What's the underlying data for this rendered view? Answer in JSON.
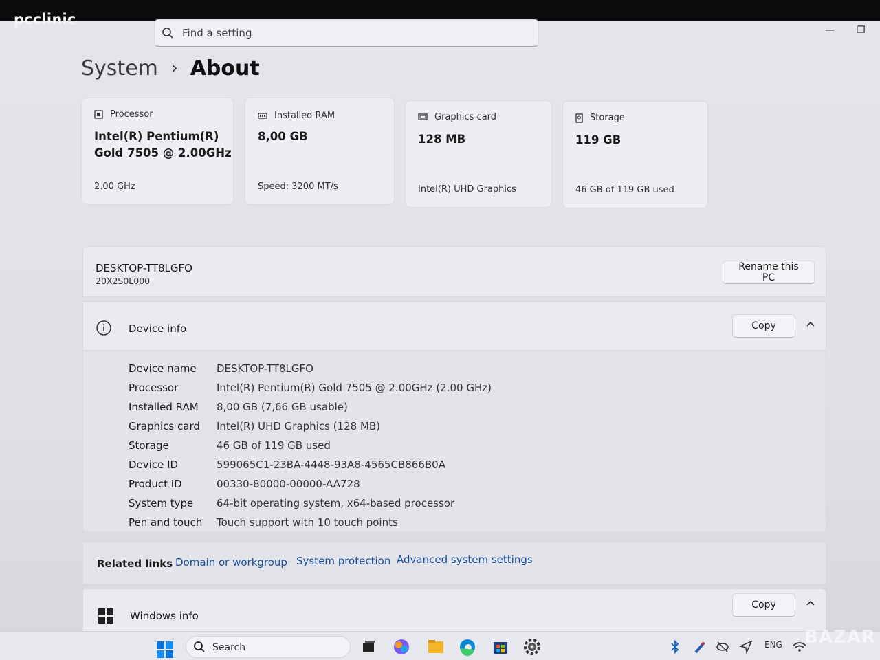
{
  "brand": "pcclinic",
  "search": {
    "placeholder": "Find a setting"
  },
  "breadcrumb": {
    "parent": "System",
    "current": "About"
  },
  "cards": [
    {
      "label": "Processor",
      "value_line1": "Intel(R) Pentium(R)",
      "value_line2": "Gold 7505 @ 2.00GHz",
      "sub": "2.00 GHz",
      "icon": "processor-icon"
    },
    {
      "label": "Installed RAM",
      "value_line1": "8,00 GB",
      "value_line2": "",
      "sub": "Speed: 3200 MT/s",
      "icon": "ram-icon"
    },
    {
      "label": "Graphics card",
      "value_line1": "128 MB",
      "value_line2": "",
      "sub": "Intel(R) UHD Graphics",
      "icon": "graphics-card-icon"
    },
    {
      "label": "Storage",
      "value_line1": "119 GB",
      "value_line2": "",
      "sub": "46 GB of 119 GB used",
      "icon": "storage-icon"
    }
  ],
  "pc": {
    "name": "DESKTOP-TT8LGFO",
    "model": "20X2S0L000",
    "rename_label": "Rename this PC"
  },
  "device_info": {
    "title": "Device info",
    "copy_label": "Copy",
    "specs": [
      {
        "key": "Device name",
        "value": "DESKTOP-TT8LGFO"
      },
      {
        "key": "Processor",
        "value": "Intel(R) Pentium(R) Gold 7505 @ 2.00GHz (2.00 GHz)"
      },
      {
        "key": "Installed RAM",
        "value": "8,00 GB (7,66 GB usable)"
      },
      {
        "key": "Graphics card",
        "value": "Intel(R) UHD Graphics (128 MB)"
      },
      {
        "key": "Storage",
        "value": "46 GB of 119 GB used"
      },
      {
        "key": "Device ID",
        "value": "599065C1-23BA-4448-93A8-4565CB866B0A"
      },
      {
        "key": "Product ID",
        "value": "00330-80000-00000-AA728"
      },
      {
        "key": "System type",
        "value": "64-bit operating system, x64-based processor"
      },
      {
        "key": "Pen and touch",
        "value": "Touch support with 10 touch points"
      }
    ]
  },
  "related": {
    "label": "Related links",
    "links": [
      "Domain or workgroup",
      "System protection",
      "Advanced system settings"
    ]
  },
  "windows_info": {
    "title": "Windows info",
    "copy_label": "Copy"
  },
  "taskbar": {
    "search_label": "Search",
    "language": "ENG"
  },
  "watermark": "BAZAR",
  "colors": {
    "link": "#1a4ea0",
    "accent": "#0067c0"
  }
}
